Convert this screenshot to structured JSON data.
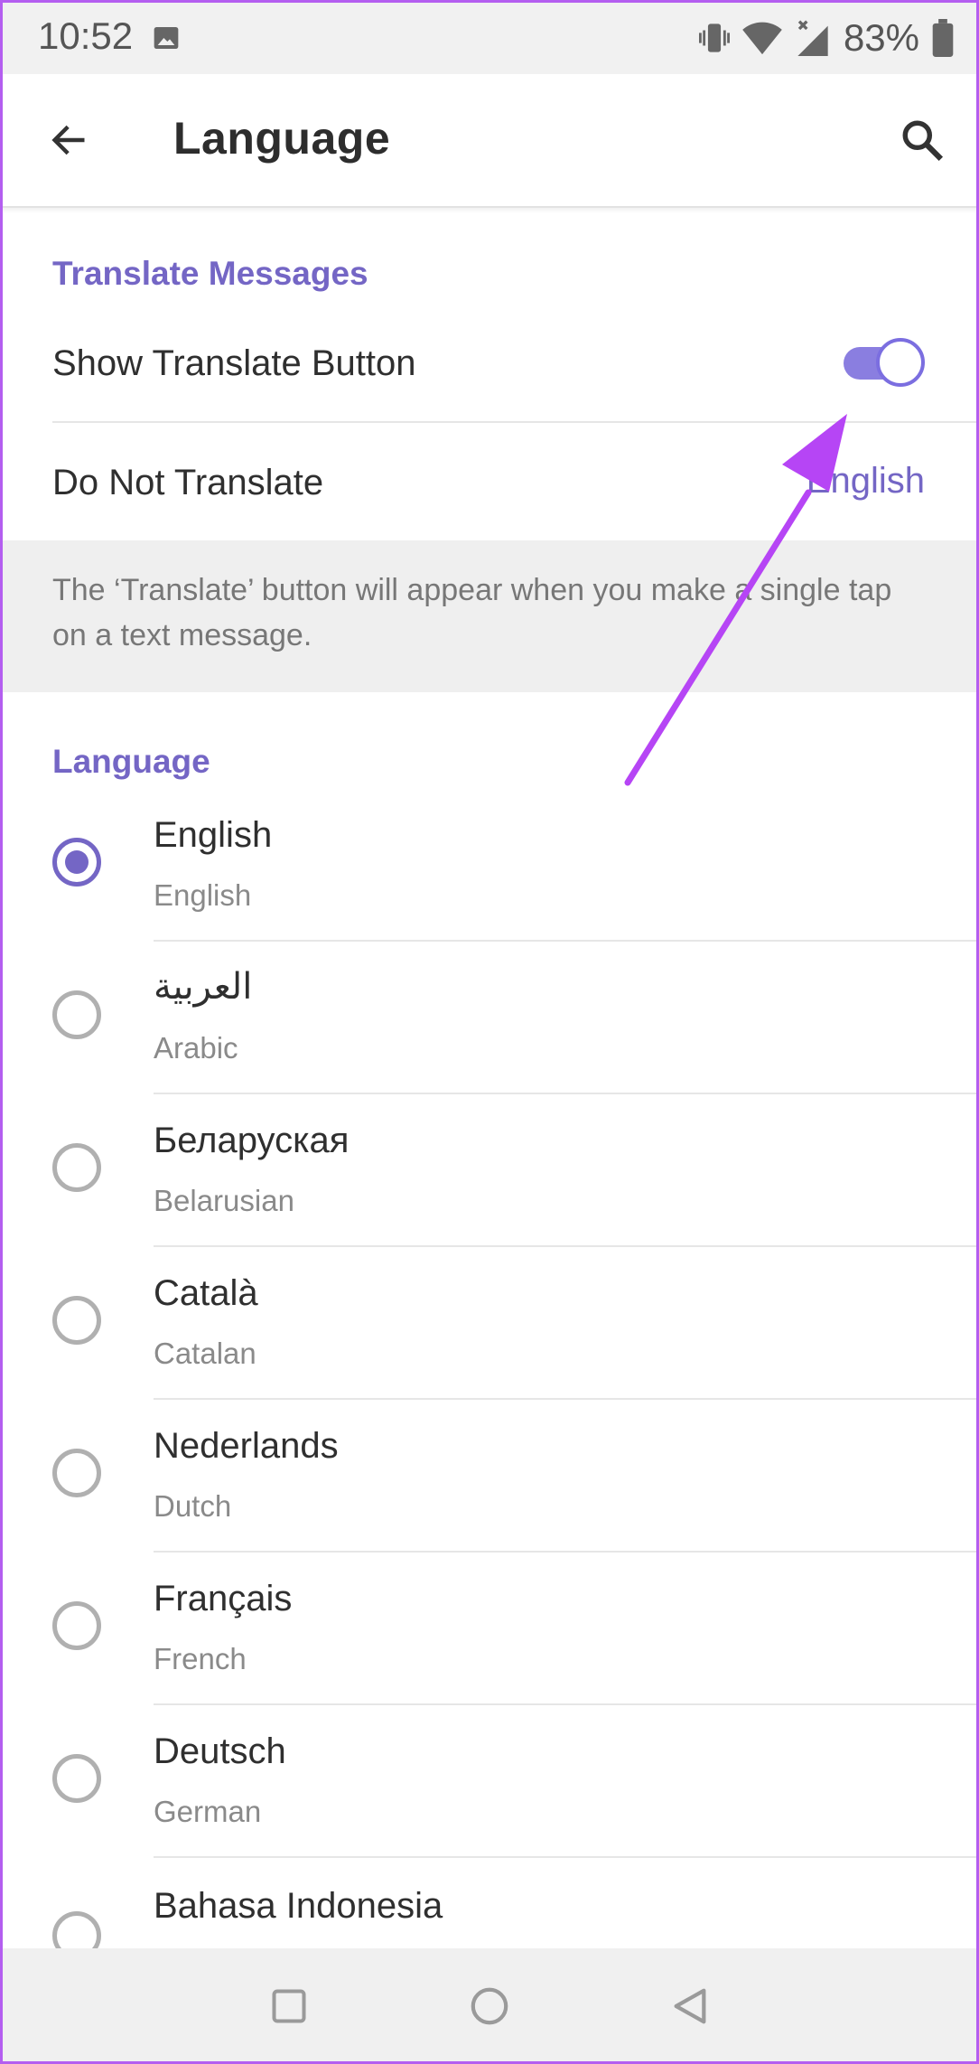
{
  "status_bar": {
    "time": "10:52",
    "battery": "83%",
    "icons": [
      "image-icon",
      "vibrate-icon",
      "wifi-icon",
      "signal-icon",
      "battery-icon"
    ]
  },
  "app_bar": {
    "title": "Language",
    "back_icon": "arrow-left-icon",
    "search_icon": "search-icon"
  },
  "translate_section": {
    "header": "Translate Messages",
    "show_translate_label": "Show Translate Button",
    "show_translate_on": true,
    "do_not_translate_label": "Do Not Translate",
    "do_not_translate_value": "English",
    "info": "The ‘Translate’ button will appear when you make a single tap on a text message."
  },
  "language_section": {
    "header": "Language",
    "items": [
      {
        "native": "English",
        "english": "English",
        "selected": true
      },
      {
        "native": "العربية",
        "english": "Arabic",
        "selected": false
      },
      {
        "native": "Беларуская",
        "english": "Belarusian",
        "selected": false
      },
      {
        "native": "Català",
        "english": "Catalan",
        "selected": false
      },
      {
        "native": "Nederlands",
        "english": "Dutch",
        "selected": false
      },
      {
        "native": "Français",
        "english": "French",
        "selected": false
      },
      {
        "native": "Deutsch",
        "english": "German",
        "selected": false
      },
      {
        "native": "Bahasa Indonesia",
        "english": "",
        "selected": false
      }
    ]
  },
  "colors": {
    "accent": "#7466c5",
    "annotation_arrow": "#b645f5"
  }
}
